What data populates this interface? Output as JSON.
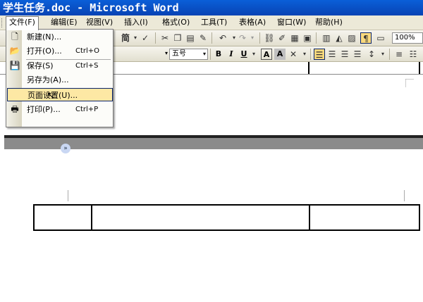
{
  "window": {
    "title": "学生任务.doc - Microsoft Word"
  },
  "menubar": {
    "items": [
      {
        "label": "文件(F)"
      },
      {
        "label": "编辑(E)"
      },
      {
        "label": "视图(V)"
      },
      {
        "label": "插入(I)"
      },
      {
        "label": "格式(O)"
      },
      {
        "label": "工具(T)"
      },
      {
        "label": "表格(A)"
      },
      {
        "label": "窗口(W)"
      },
      {
        "label": "帮助(H)"
      }
    ]
  },
  "toolbar": {
    "simplified_label": "简",
    "zoom": "100%",
    "font_size": "五号",
    "bold": "B",
    "italic": "I",
    "underline": "U",
    "char_border": "A",
    "char_shading": "A"
  },
  "file_menu": {
    "items": [
      {
        "label": "新建(N)...",
        "shortcut": ""
      },
      {
        "label": "打开(O)...",
        "shortcut": "Ctrl+O"
      },
      {
        "label": "保存(S)",
        "shortcut": "Ctrl+S"
      },
      {
        "label": "另存为(A)...",
        "shortcut": ""
      },
      {
        "label": "页面设置(U)...",
        "shortcut": ""
      },
      {
        "label": "打印(P)...",
        "shortcut": "Ctrl+P"
      }
    ]
  },
  "colors": {
    "title_bar": "#0a5fd8",
    "menu_highlight": "#fde8a4"
  }
}
